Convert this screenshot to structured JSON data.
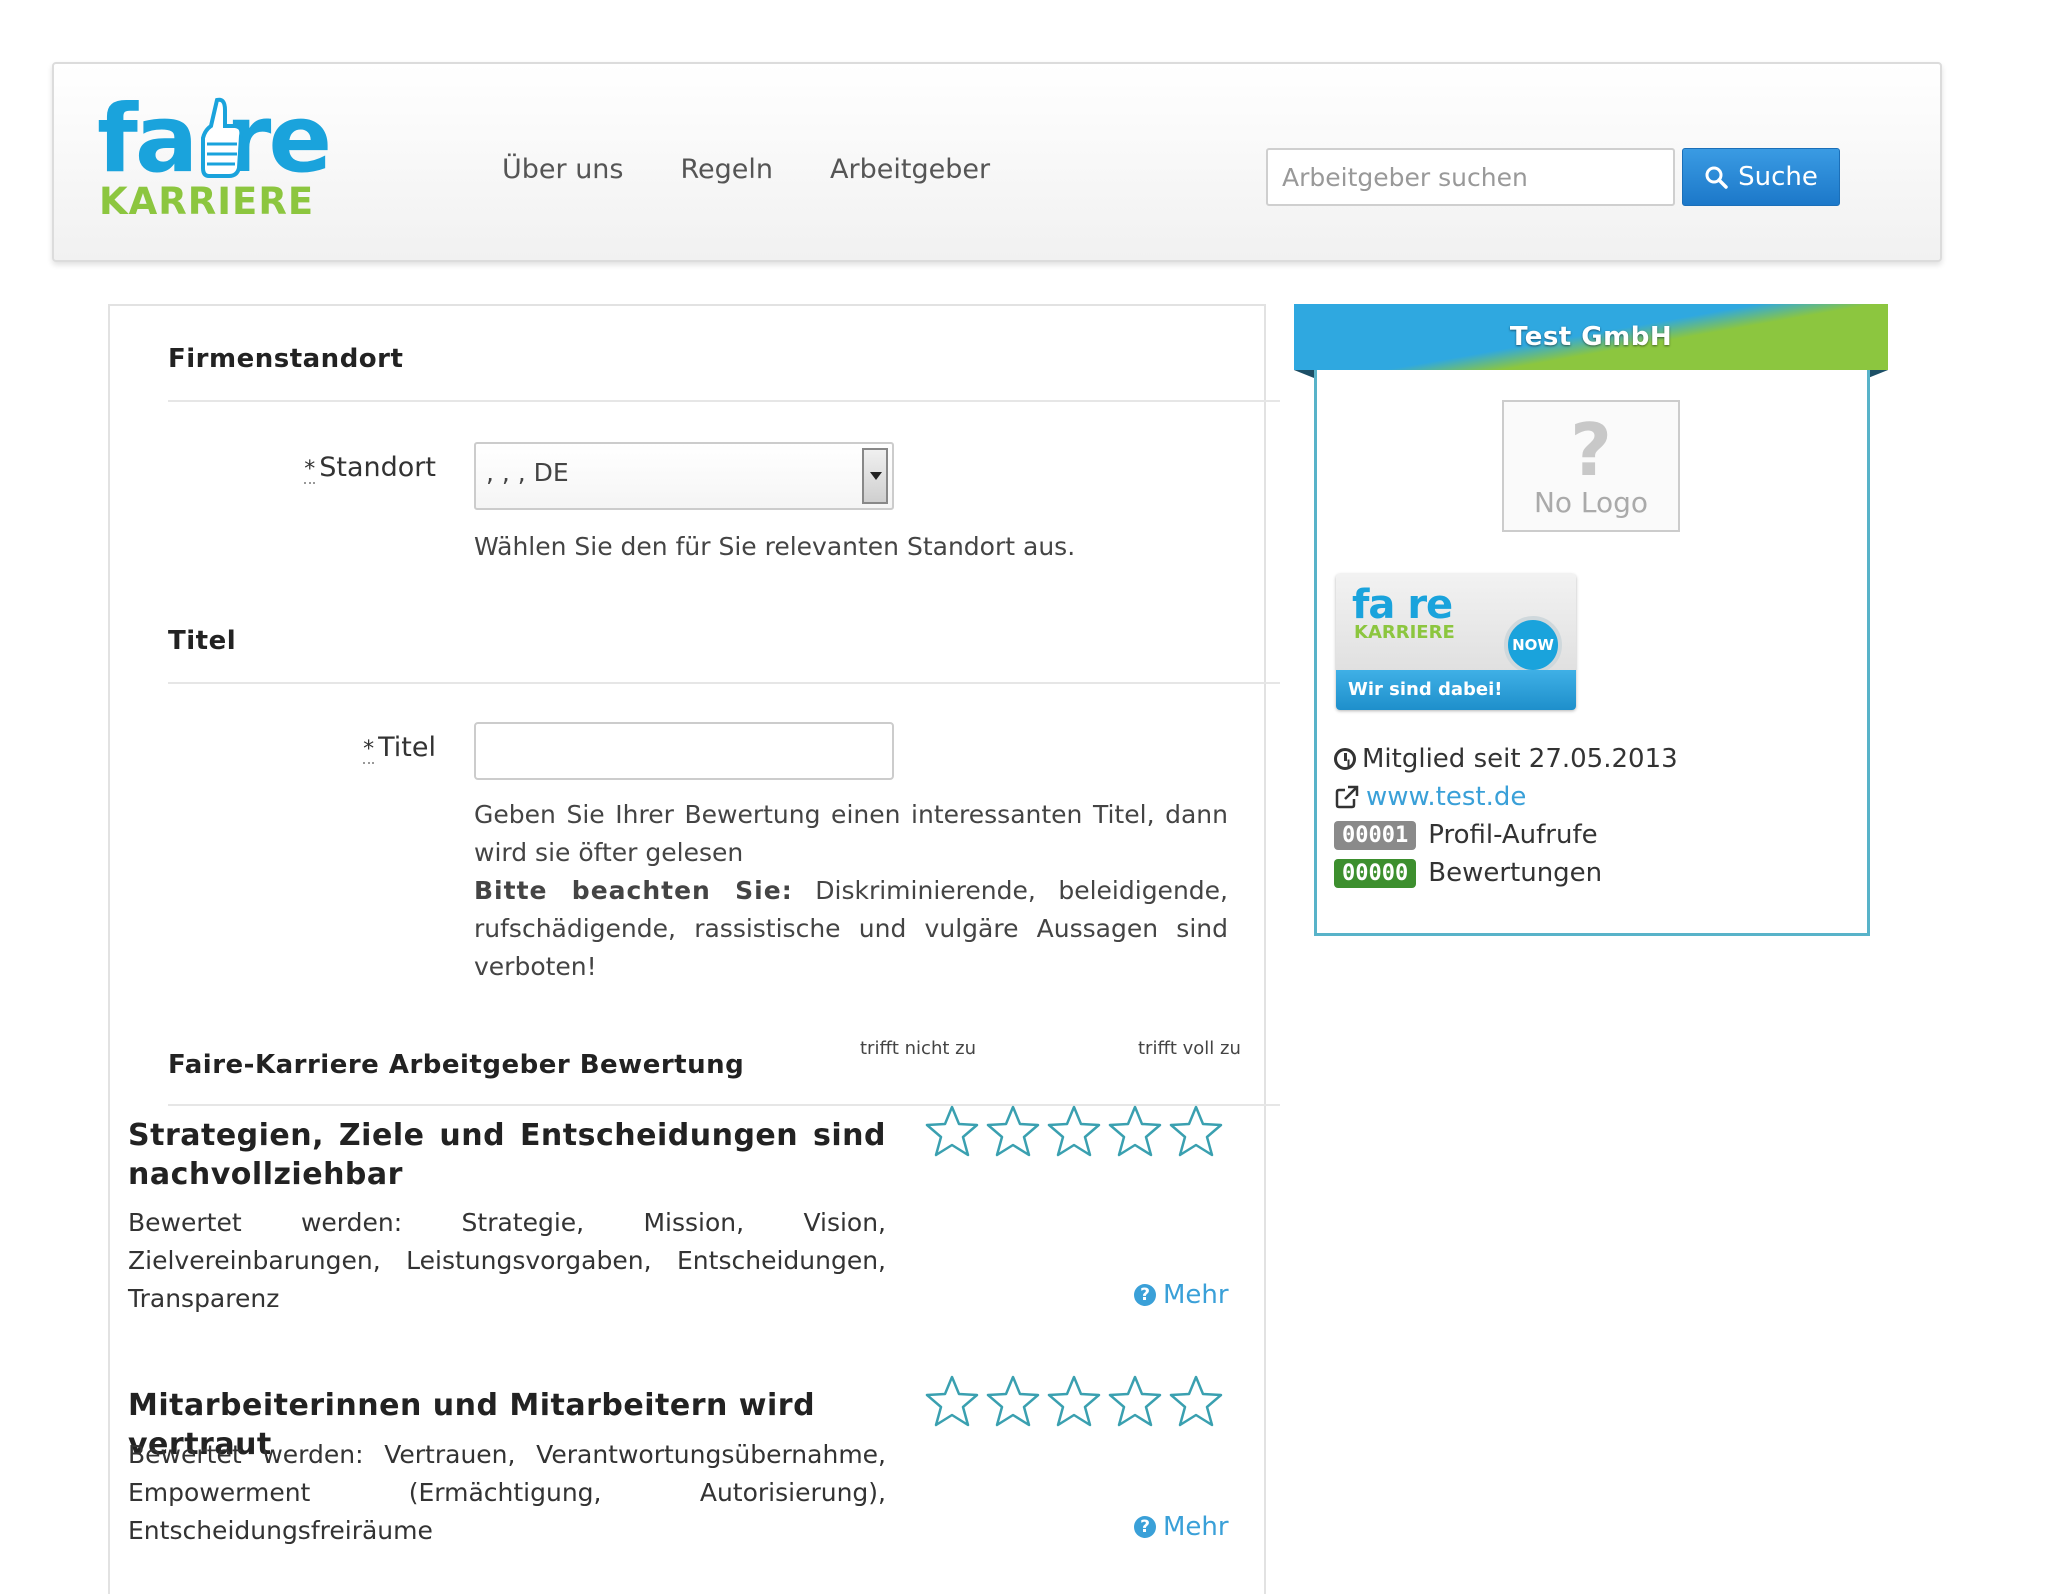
{
  "brand": {
    "logo_top": "fa re",
    "logo_bottom": "KARRIERE"
  },
  "nav": {
    "items": [
      "Über uns",
      "Regeln",
      "Arbeitgeber"
    ]
  },
  "search": {
    "placeholder": "Arbeitgeber suchen",
    "value": "",
    "button_label": "Suche",
    "icon": "search-icon"
  },
  "form": {
    "location_section": "Firmenstandort",
    "location_label": "Standort",
    "location_required": "*",
    "location_value": ", , , DE",
    "location_help": "Wählen Sie den für Sie relevanten Standort aus.",
    "title_section": "Titel",
    "title_label": "Titel",
    "title_required": "*",
    "title_value": "",
    "title_help": "Geben Sie Ihrer Bewertung einen interessanten Titel, dann wird sie öfter gelesen",
    "warning_bold": "Bitte beachten Sie:",
    "warning_text": "Diskriminierende, beleidigende, rufschädigende, rassistische und vulgäre Aussagen sind verboten!",
    "rating_section": "Faire-Karriere Arbeitgeber Bewertung",
    "scale_low": "trifft nicht zu",
    "scale_high": "trifft voll zu",
    "criteria": [
      {
        "title": "Strategien, Ziele und Entscheidungen sind nachvollziehbar",
        "desc": "Bewertet werden: Strategie, Mission, Vision, Zielvereinbarungen, Leistungsvorgaben, Entscheidungen, Transparenz",
        "rating": 0,
        "max": 5,
        "more": "Mehr"
      },
      {
        "title": "Mitarbeiterinnen und Mitarbeitern wird vertraut",
        "desc": "Bewertet werden: Vertrauen, Verantwortungsübernahme, Empowerment (Ermächtigung, Autorisierung), Entscheidungsfreiräume",
        "rating": 0,
        "max": 5,
        "more": "Mehr"
      }
    ]
  },
  "company": {
    "name": "Test GmbH",
    "no_logo_text": "No Logo",
    "no_logo_glyph": "?",
    "badge": {
      "fa": "fa re",
      "karriere": "KARRIERE",
      "now": "NOW",
      "tagline": "Wir sind dabei!"
    },
    "member_since": "Mitglied seit 27.05.2013",
    "website": "www.test.de",
    "profile_views_count": "00001",
    "profile_views_label": "Profil-Aufrufe",
    "reviews_count": "00000",
    "reviews_label": "Bewertungen",
    "colors": {
      "ribbon_blue": "#2fa8e0",
      "ribbon_green": "#8cc63f",
      "views_badge": "#8a8a8a",
      "reviews_badge": "#3d8f2e"
    }
  },
  "colors": {
    "brand_blue": "#1aa3dc",
    "brand_green": "#8cc63f",
    "star_outline": "#3aa0b0",
    "link": "#3aa0d8"
  }
}
